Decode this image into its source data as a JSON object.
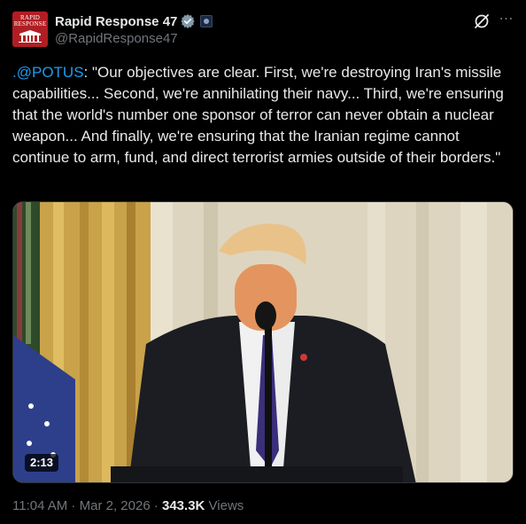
{
  "account": {
    "avatar_line1": "RAPID",
    "avatar_line2": "RESPONSE",
    "display_name": "Rapid Response 47",
    "handle": "@RapidResponse47"
  },
  "tweet": {
    "mention": ".@POTUS",
    "text": ": \"Our objectives are clear. First, we're destroying Iran's missile capabilities... Second, we're annihilating their navy... Third, we're ensuring that the world's number one sponsor of terror can never obtain a nuclear weapon... And finally, we're ensuring that the Iranian regime cannot continue to arm, fund, and direct terrorist armies outside of their borders.\""
  },
  "media": {
    "duration": "2:13"
  },
  "meta": {
    "time": "11:04 AM",
    "separator1": " · ",
    "date": "Mar 2, 2026",
    "separator2": " · ",
    "views_count": "343.3K",
    "views_label": " Views"
  },
  "icons": {
    "verified": "verified-badge-icon",
    "affiliate": "affiliate-badge-icon",
    "grok": "grok-icon",
    "more": "more-icon"
  },
  "colors": {
    "background": "#000000",
    "text": "#e7e9ea",
    "secondary": "#71767b",
    "link": "#1d9bf0",
    "avatar": "#b01e23"
  }
}
